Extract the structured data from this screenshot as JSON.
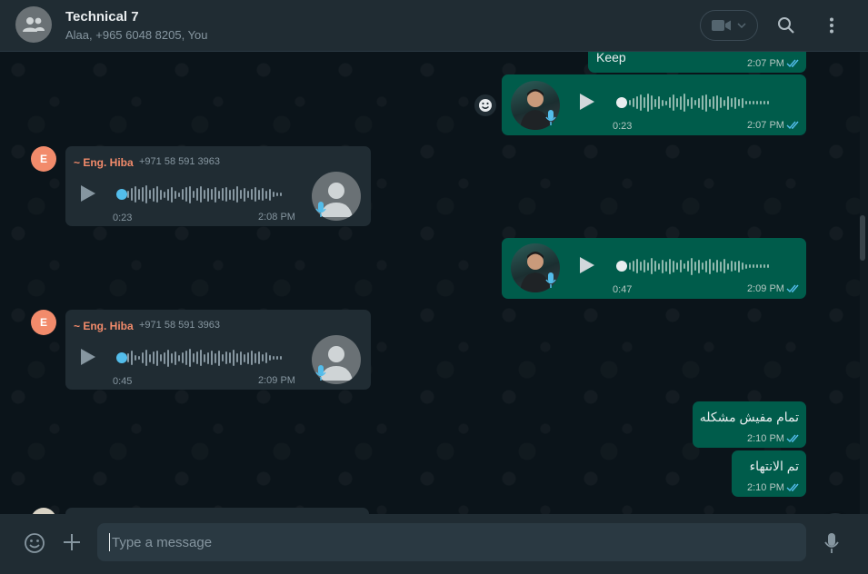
{
  "header": {
    "title": "Technical 7",
    "subtitle": "Alaa, +965 6048 8205, You"
  },
  "messages": {
    "m1": {
      "text": "Keep",
      "time": "2:07 PM"
    },
    "m2": {
      "duration": "0:23",
      "time": "2:07 PM"
    },
    "m3": {
      "sender_initial": "E",
      "sender_name": "~ Eng. Hiba",
      "sender_phone": "+971 58 591 3963",
      "duration": "0:23",
      "time": "2:08 PM"
    },
    "m4": {
      "duration": "0:47",
      "time": "2:09 PM"
    },
    "m5": {
      "sender_initial": "E",
      "sender_name": "~ Eng. Hiba",
      "sender_phone": "+971 58 591 3963",
      "duration": "0:45",
      "time": "2:09 PM"
    },
    "m6": {
      "text": "تمام مفيش مشكله",
      "time": "2:10 PM"
    },
    "m7": {
      "text": "تم الانتهاء",
      "time": "2:10 PM"
    }
  },
  "composer": {
    "placeholder": "Type a message"
  },
  "colors": {
    "outgoing_bubble": "#005c4b",
    "incoming_bubble": "#202c33",
    "sender_name": "#f28b6b",
    "read_ticks": "#53bdeb",
    "panel": "#202c33"
  },
  "icons": [
    "group-icon",
    "video-camera-icon",
    "chevron-down-icon",
    "search-icon",
    "menu-icon",
    "smiley-icon",
    "play-icon",
    "mic-icon",
    "plus-icon",
    "emoji-icon",
    "double-check-icon"
  ]
}
